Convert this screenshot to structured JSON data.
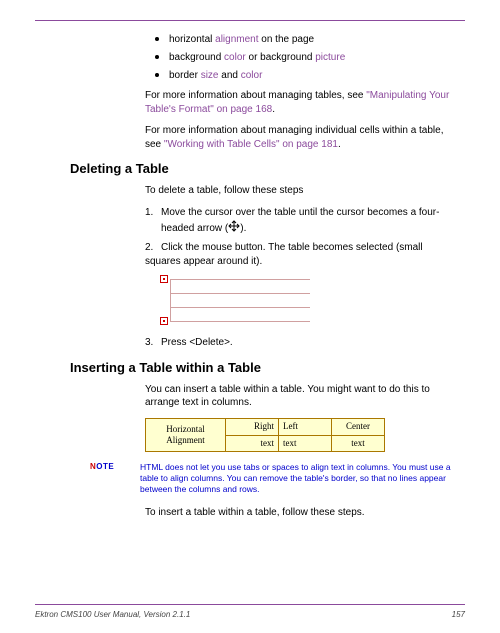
{
  "bullets": {
    "b1_pre": "horizontal ",
    "b1_link": "alignment",
    "b1_post": " on the page",
    "b2_pre": "background ",
    "b2_link1": "color",
    "b2_mid": " or background ",
    "b2_link2": "picture",
    "b3_pre": "border ",
    "b3_link1": "size",
    "b3_mid": " and ",
    "b3_link2": "color"
  },
  "para1": {
    "pre": "For more information about managing tables, see  ",
    "link": "\"Manipulating Your Table's Format\" on page 168",
    "post": "."
  },
  "para2": {
    "pre": "For more information about managing individual cells within a table, see  ",
    "link": "\"Working with Table Cells\" on page 181",
    "post": "."
  },
  "h1": "Deleting a Table",
  "del_intro": "To delete a table, follow these steps",
  "del_s1a": "Move the cursor over the table until the cursor becomes a four-",
  "del_s1b": "headed arrow (",
  "del_s1c": ").",
  "del_s2": "Click the mouse button. The table becomes selected (small squares appear around it).",
  "del_s3": "Press <Delete>.",
  "h2": "Inserting a Table within a Table",
  "ins_para": "You can insert a table within a table. You might want to do this to arrange text in columns.",
  "nested": {
    "label": "Horizontal Alignment",
    "r1c1": "Right",
    "r1c2": "Left",
    "r1c3": "Center",
    "r2c1": "text",
    "r2c2": "text",
    "r2c3": "text"
  },
  "note_label_n": "N",
  "note_label_rest": "OTE",
  "note_text": "HTML does not let you use tabs or spaces to align text in columns. You must use a table to align columns. You can remove the table's border, so that no lines appear between the columns and rows.",
  "ins_last": "To insert a table within a table, follow these steps.",
  "footer_left": "Ektron CMS100 User Manual, Version 2.1.1",
  "footer_right": "157"
}
